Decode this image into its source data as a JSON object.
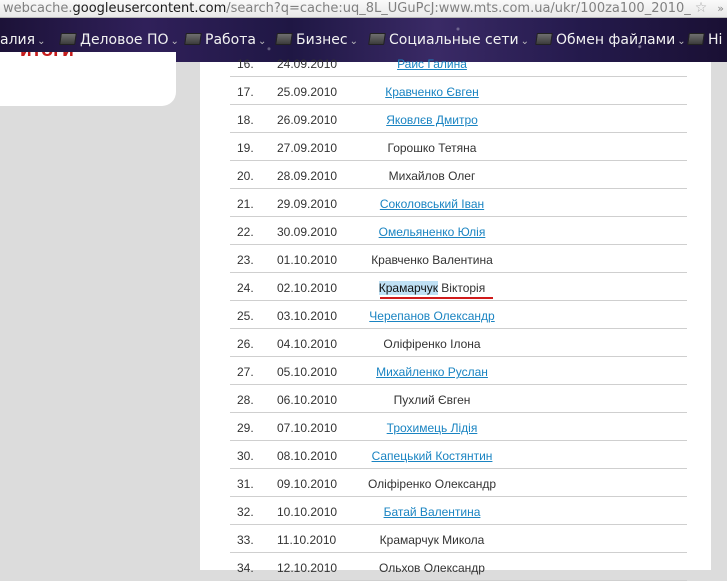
{
  "browser": {
    "url_prefix": "webcache.",
    "url_host": "googleusercontent.com",
    "url_rest": "/search?q=cache:uq_8L_UGuPcJ:www.mts.com.ua/ukr/100za100_2010_",
    "star_icon": "☆",
    "overflow_icon": "»"
  },
  "bookmarks": [
    {
      "label": "алия",
      "folder": false
    },
    {
      "label": "Деловое ПО",
      "folder": true
    },
    {
      "label": "Работа",
      "folder": true
    },
    {
      "label": "Бизнес",
      "folder": true
    },
    {
      "label": "Социальные сети",
      "folder": true
    },
    {
      "label": "Обмен файлами",
      "folder": true
    },
    {
      "label": "Hi",
      "folder": true
    }
  ],
  "left_box": {
    "red_text": "ИТОГИ"
  },
  "table": {
    "rows": [
      {
        "num": "16.",
        "date": "24.09.2010",
        "name": "Раис Галина",
        "link": true
      },
      {
        "num": "17.",
        "date": "25.09.2010",
        "name": "Кравченко Євген",
        "link": true
      },
      {
        "num": "18.",
        "date": "26.09.2010",
        "name": "Яковлєв Дмитро",
        "link": true
      },
      {
        "num": "19.",
        "date": "27.09.2010",
        "name": "Горошко Тетяна",
        "link": false
      },
      {
        "num": "20.",
        "date": "28.09.2010",
        "name": "Михайлов Олег",
        "link": false
      },
      {
        "num": "21.",
        "date": "29.09.2010",
        "name": "Соколовський Іван",
        "link": true
      },
      {
        "num": "22.",
        "date": "30.09.2010",
        "name": "Омельяненко Юлія",
        "link": true
      },
      {
        "num": "23.",
        "date": "01.10.2010",
        "name": "Кравченко Валентина",
        "link": false
      },
      {
        "num": "24.",
        "date": "02.10.2010",
        "name_highlight": "Крамарчук",
        "name_rest": " Вікторія",
        "link": false,
        "highlighted": true
      },
      {
        "num": "25.",
        "date": "03.10.2010",
        "name": "Черепанов Олександр",
        "link": true
      },
      {
        "num": "26.",
        "date": "04.10.2010",
        "name": "Оліфіренко Ілона",
        "link": false
      },
      {
        "num": "27.",
        "date": "05.10.2010",
        "name": "Михайленко Руслан",
        "link": true
      },
      {
        "num": "28.",
        "date": "06.10.2010",
        "name": "Пухлий Євген",
        "link": false
      },
      {
        "num": "29.",
        "date": "07.10.2010",
        "name": "Трохимець Лідія",
        "link": true
      },
      {
        "num": "30.",
        "date": "08.10.2010",
        "name": "Сапецький Костянтин",
        "link": true
      },
      {
        "num": "31.",
        "date": "09.10.2010",
        "name": "Оліфіренко Олександр",
        "link": false
      },
      {
        "num": "32.",
        "date": "10.10.2010",
        "name": "Батай Валентина",
        "link": true
      },
      {
        "num": "33.",
        "date": "11.10.2010",
        "name": "Крамарчук Микола",
        "link": false
      },
      {
        "num": "34.",
        "date": "12.10.2010",
        "name": "Ольхов Олександр",
        "link": false
      }
    ]
  }
}
